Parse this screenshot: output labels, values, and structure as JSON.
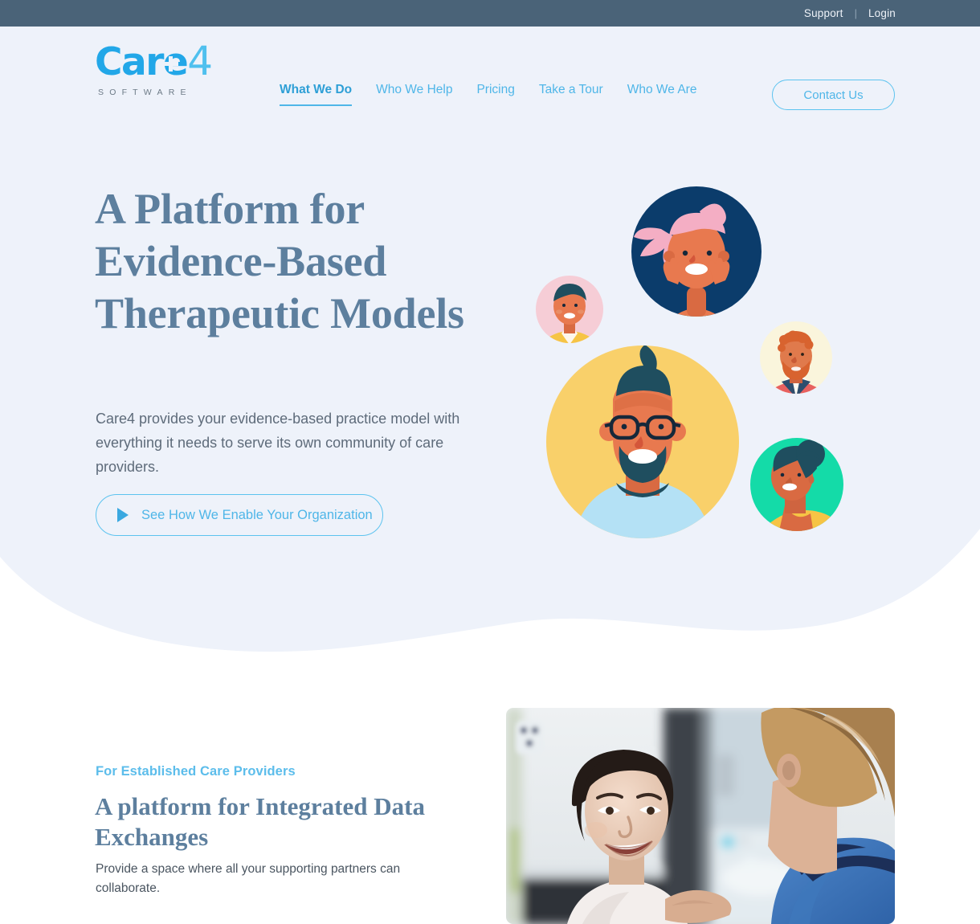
{
  "topbar": {
    "support_label": "Support",
    "separator": "|",
    "login_label": "Login"
  },
  "logo": {
    "text": "Care",
    "numeral": "4",
    "subtitle": "SOFTWARE",
    "brand_color": "#22a7e8",
    "accent_color": "#4fc0ee"
  },
  "nav": {
    "items": [
      {
        "label": "What We Do",
        "active": true
      },
      {
        "label": "Who We Help",
        "active": false
      },
      {
        "label": "Pricing",
        "active": false
      },
      {
        "label": "Take a Tour",
        "active": false
      },
      {
        "label": "Who We Are",
        "active": false
      }
    ],
    "contact_label": "Contact Us"
  },
  "hero": {
    "title": "A Platform for Evidence-Based Therapeutic Models",
    "subtitle": "Care4 provides your evidence-based practice model with everything it needs to serve its own community of care providers.",
    "cta_label": "See How We Enable Your Organization",
    "background_color": "#eef2fa",
    "title_color": "#5d7f9e",
    "illustration": {
      "name": "avatar-cluster",
      "avatars": [
        {
          "id": "avatar-pink-hair",
          "circle_color": "#0b3c6b",
          "skin": "#e8794f",
          "hair": "#f4aec4",
          "shirt": "#1fd3a8",
          "size": "large"
        },
        {
          "id": "avatar-yellow-shirt-small",
          "circle_color": "#f6cdd6",
          "skin": "#e8794f",
          "hair": "#1f4e5f",
          "shirt": "#f6c445",
          "size": "small"
        },
        {
          "id": "avatar-glasses-beard",
          "circle_color": "#f9d06a",
          "skin": "#e8794f",
          "hair": "#1f4e5f",
          "shirt": "#b4e1f5",
          "size": "xlarge"
        },
        {
          "id": "avatar-red-collar-beard",
          "circle_color": "#faf5dc",
          "skin": "#e07a4c",
          "hair": "#d8632f",
          "shirt": "#e8615f",
          "size": "small"
        },
        {
          "id": "avatar-bun-teal",
          "circle_color": "#14dba8",
          "skin": "#d96a42",
          "hair": "#1f4e5f",
          "shirt": "#f6c445",
          "size": "medium"
        }
      ]
    }
  },
  "section": {
    "eyebrow": "For Established Care Providers",
    "eyebrow_color": "#5cbdeb",
    "title": "A platform for Integrated Data Exchanges",
    "body": "Provide a space where all your supporting partners can collaborate.",
    "photo_alt": "Smiling patient talking with a nurse in blue scrubs"
  }
}
